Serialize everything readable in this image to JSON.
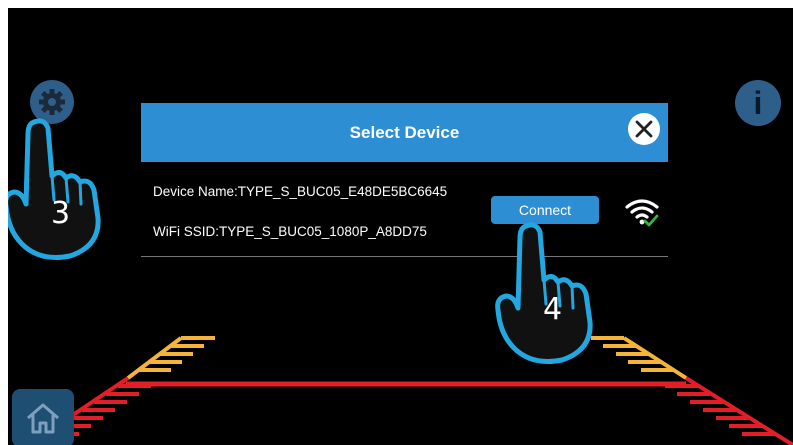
{
  "dialog": {
    "title": "Select Device",
    "device_name": "Device Name:TYPE_S_BUC05_E48DE5BC6645",
    "wifi_ssid": "WiFi SSID:TYPE_S_BUC05_1080P_A8DD75",
    "connect_label": "Connect"
  },
  "toolbar": {
    "info_label": "i"
  },
  "steps": {
    "settings_step": "3",
    "connect_step": "4"
  },
  "icons": {
    "settings": "gear-icon",
    "info": "info-icon",
    "close": "close-icon",
    "wifi": "wifi-connected-icon",
    "home": "home-icon"
  },
  "colors": {
    "screen_background": "#000000",
    "accent_blue": "#2d8ed4",
    "icon_button_blue": "#2e5f8a",
    "guide_red": "#e21e26",
    "guide_yellow": "#f4b43a",
    "hand_outline": "#22a7e0"
  }
}
